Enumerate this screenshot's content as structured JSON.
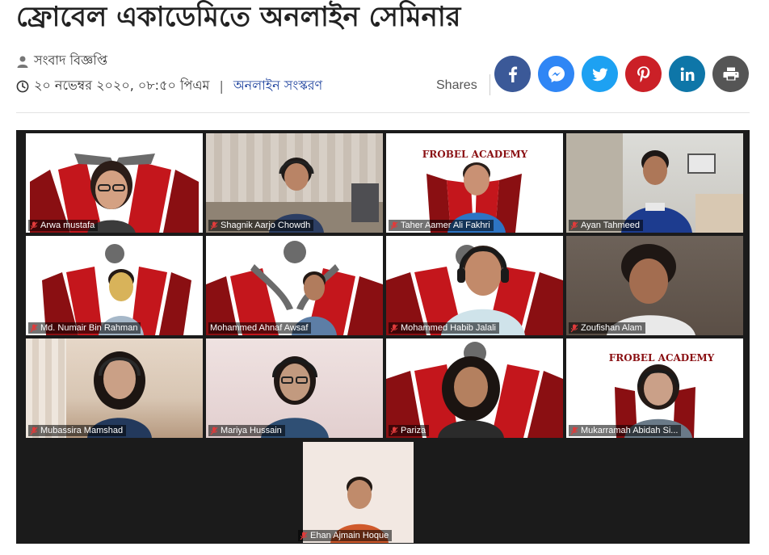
{
  "article": {
    "headline": "ফ্রোবেল একাডেমিতে অনলাইন সেমিনার",
    "author": "সংবাদ বিজ্ঞপ্তি",
    "date": "২০ নভেম্বর ২০২০, ০৮:৫০ পিএম",
    "edition": "অনলাইন সংস্করণ"
  },
  "share": {
    "label": "Shares",
    "buttons": [
      {
        "name": "facebook",
        "icon": "facebook-icon",
        "color": "#3b5998"
      },
      {
        "name": "messenger",
        "icon": "messenger-icon",
        "color": "#2f86f5"
      },
      {
        "name": "twitter",
        "icon": "twitter-icon",
        "color": "#1da1f2"
      },
      {
        "name": "pinterest",
        "icon": "pinterest-icon",
        "color": "#cb2027"
      },
      {
        "name": "linkedin",
        "icon": "linkedin-icon",
        "color": "#0e76a8"
      },
      {
        "name": "print",
        "icon": "print-icon",
        "color": "#555555"
      }
    ]
  },
  "photo": {
    "logo_text": "FROBEL ACADEMY",
    "participants": [
      {
        "name": "Arwa mustafa"
      },
      {
        "name": "Shagnik Aarjo Chowdh"
      },
      {
        "name": "Taher Aamer Ali Fakhri"
      },
      {
        "name": "Ayan Tahmeed"
      },
      {
        "name": "Md. Numair Bin Rahman"
      },
      {
        "name": "Mohammed Ahnaf Awsaf"
      },
      {
        "name": "Mohammed Habib Jalali"
      },
      {
        "name": "Zoufishan Alam"
      },
      {
        "name": "Mubassira Mamshad"
      },
      {
        "name": "Mariya Hussain"
      },
      {
        "name": "Pariza"
      },
      {
        "name": "Mukarramah Abidah Si..."
      },
      {
        "name": "Ehan Ajmain Hoque"
      }
    ]
  },
  "colors": {
    "logo_red": "#c4161c",
    "logo_dark_red": "#8a0f12",
    "logo_grey": "#6b6b6b",
    "edition_blue": "#1a3f9c"
  }
}
